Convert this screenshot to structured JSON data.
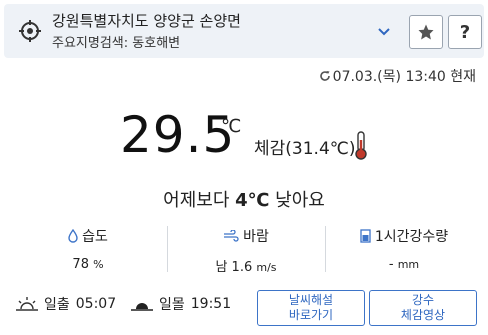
{
  "location": {
    "name": "강원특별자치도 양양군 손양면",
    "landmark": "주요지명검색: 동호해변"
  },
  "buttons": {
    "favorite_icon": "star-icon",
    "help_label": "?"
  },
  "observation": {
    "time": "07.03.(목) 13:40 현재"
  },
  "current": {
    "temperature": "29.5",
    "unit": "℃",
    "feels_like": "체감(31.4℃)"
  },
  "comparison": {
    "prefix": "어제보다 ",
    "diff": "4℃",
    "suffix": " 낮아요"
  },
  "stats": [
    {
      "label": "습도",
      "value": "78",
      "unit": "%"
    },
    {
      "label": "바람",
      "value": "남 1.6",
      "unit": "m/s"
    },
    {
      "label": "1시간강수량",
      "value": "-",
      "unit": "mm"
    }
  ],
  "sun": {
    "sunrise_label": "일출",
    "sunrise_time": "05:07",
    "sunset_label": "일몰",
    "sunset_time": "19:51"
  },
  "actions": {
    "weather_explain_line1": "날씨해설",
    "weather_explain_line2": "바로가기",
    "rain_video_line1": "강수",
    "rain_video_line2": "체감영상"
  },
  "colors": {
    "accent": "#2f67c0",
    "bar_bg": "#eef2f7",
    "thermo_red": "#c0392b"
  }
}
